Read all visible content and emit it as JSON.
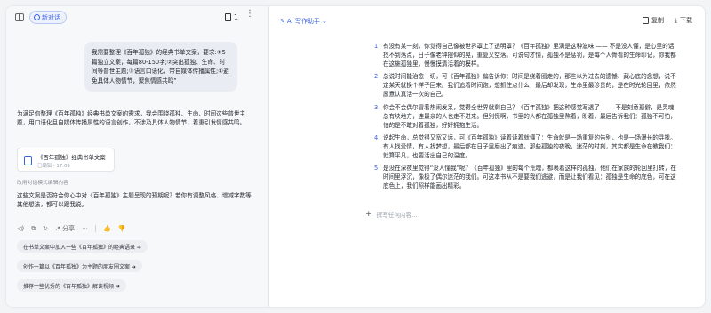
{
  "left": {
    "new_chat_label": "新对话",
    "doc_count": "1",
    "user_prompt": "我需要整理《百年孤独》的经典书单文案，要求:①5篇独立文案，每篇80-150字;②突出孤独、生命、时间等普世主题;③语言口语化，带自媒体传播属性;④避免具体人物情节，聚焦情感共鸣”",
    "ai_response": "为满足你整理《百年孤独》经典书单文案的需求，我会围绕孤独、生命、时间这些普世主题，用口语化且自媒体传播属性的语言创作，不涉及具体人物情节，着重引发情感共鸣。",
    "doc_card_title": "《百年孤独》经典书单文案",
    "doc_card_sub": "已编辑 · 17:09",
    "edited_note": "改用对话模式编辑内容",
    "ai_question": "这些文案是否符合你心中对《百年孤独》主题呈现的预期呢？若你有调整风格、增减字数等其他想法，都可以跟我说。",
    "actions": {
      "copy": "⧉",
      "regen": "↻",
      "share_label": "分享",
      "like": "👍",
      "dislike": "👎"
    },
    "chips": [
      "在书单文案中加入一些《百年孤独》的经典语录 ➔",
      "创作一篇以《百年孤独》为主题的朋友圈文案 ➔",
      "推荐一些优秀的《百年孤独》解读视频 ➔"
    ]
  },
  "right": {
    "ai_writer_label": "AI 写作助手",
    "copy_label": "复制",
    "download_label": "下载",
    "items": [
      {
        "num": "1.",
        "text": "有没有某一刻，你觉得自己像被世界罩上了透明罩？《百年孤独》里满是这种滋味 —— 不是没人懂，是心里的话找不到落点，日子像老钟摆似的晃，重复又空落。可说句才懂，孤独不是惩罚，是每个人骨看的生命印记，你我都在这施孤独里，慢慢摸清活着的模样。"
      },
      {
        "num": "2.",
        "text": "总说时间能治愈一切，可《百年孤独》偏告诉你：时间是绕着圈走的，那些以为过去的遗憾、藏心底的念想，说不定某天就换个样子回来。我们追着时间跑，想抓住点什么，最后却发现，生命里最珍贵的，是在时光轮回里，依然愿意认真活一次的自己。"
      },
      {
        "num": "3.",
        "text": "你会不会偶尔冒着热闹发呆，觉得全世界就剩自己？《百年孤独》把这种感觉写透了 —— 不是刻意孤僻，是灵魂总有块地方，连最亲的人也走不进来。但别慌啊，书里的人都在孤独里熬着，盼着，最后告诉我们：孤独不可怕，怕的是不敢对着孤独，好好拥抱生活。"
      },
      {
        "num": "4.",
        "text": "说起生命，总觉得又宽又远，可《百年孤独》读着读着就懂了：生命就是一场重复的告别，也是一场漫长的寻找。有人找爱情，有人找梦想，最后都在日子里磨出了痕迹。那些孤独的夜晚，迷茫的时刻，其实都是生命在教我们：就算平凡，也要活出自己的温度。"
      },
      {
        "num": "5.",
        "text": "是没在深夜里觉得“没人懂我”呢？《百年孤独》里的每个荒魂，都裹着这样的孤独。他们在家族的轮回里打转，在时间里浮沉，像极了偶尔迷茫的我们。可这本书从不是要我们逃避，而是让我们看见：孤独是生命的底色，可在这底色上，我们照样能画出精彩。"
      }
    ],
    "prompt_placeholder": "撰写任何内容..."
  }
}
